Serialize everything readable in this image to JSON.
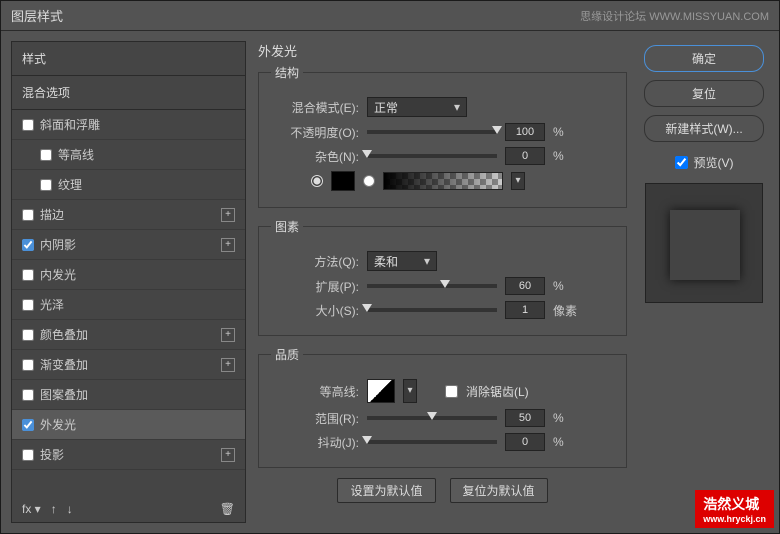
{
  "titlebar": {
    "title": "图层样式",
    "right": "思缘设计论坛  WWW.MISSYUAN.COM"
  },
  "sidebar": {
    "styles_label": "样式",
    "blend_options": "混合选项",
    "items": [
      {
        "label": "斜面和浮雕",
        "checked": false,
        "plus": false
      },
      {
        "label": "等高线",
        "checked": false,
        "plus": false,
        "indent": true
      },
      {
        "label": "纹理",
        "checked": false,
        "plus": false,
        "indent": true
      },
      {
        "label": "描边",
        "checked": false,
        "plus": true
      },
      {
        "label": "内阴影",
        "checked": true,
        "plus": true
      },
      {
        "label": "内发光",
        "checked": false,
        "plus": false
      },
      {
        "label": "光泽",
        "checked": false,
        "plus": false
      },
      {
        "label": "颜色叠加",
        "checked": false,
        "plus": true
      },
      {
        "label": "渐变叠加",
        "checked": false,
        "plus": true
      },
      {
        "label": "图案叠加",
        "checked": false,
        "plus": false
      },
      {
        "label": "外发光",
        "checked": true,
        "plus": false,
        "selected": true
      },
      {
        "label": "投影",
        "checked": false,
        "plus": true
      }
    ],
    "footer_fx": "fx"
  },
  "main": {
    "title": "外发光",
    "structure": {
      "legend": "结构",
      "blend_mode_label": "混合模式(E):",
      "blend_mode_value": "正常",
      "opacity_label": "不透明度(O):",
      "opacity_value": "100",
      "opacity_unit": "%",
      "noise_label": "杂色(N):",
      "noise_value": "0",
      "noise_unit": "%"
    },
    "elements": {
      "legend": "图素",
      "method_label": "方法(Q):",
      "method_value": "柔和",
      "spread_label": "扩展(P):",
      "spread_value": "60",
      "spread_unit": "%",
      "size_label": "大小(S):",
      "size_value": "1",
      "size_unit": "像素"
    },
    "quality": {
      "legend": "品质",
      "contour_label": "等高线:",
      "antialias_label": "消除锯齿(L)",
      "range_label": "范围(R):",
      "range_value": "50",
      "range_unit": "%",
      "jitter_label": "抖动(J):",
      "jitter_value": "0",
      "jitter_unit": "%"
    },
    "buttons": {
      "make_default": "设置为默认值",
      "reset_default": "复位为默认值"
    }
  },
  "rightcol": {
    "ok": "确定",
    "reset": "复位",
    "new_style": "新建样式(W)...",
    "preview_label": "预览(V)"
  },
  "watermark": {
    "main": "浩然义城",
    "sub": "www.hryckj.cn"
  }
}
